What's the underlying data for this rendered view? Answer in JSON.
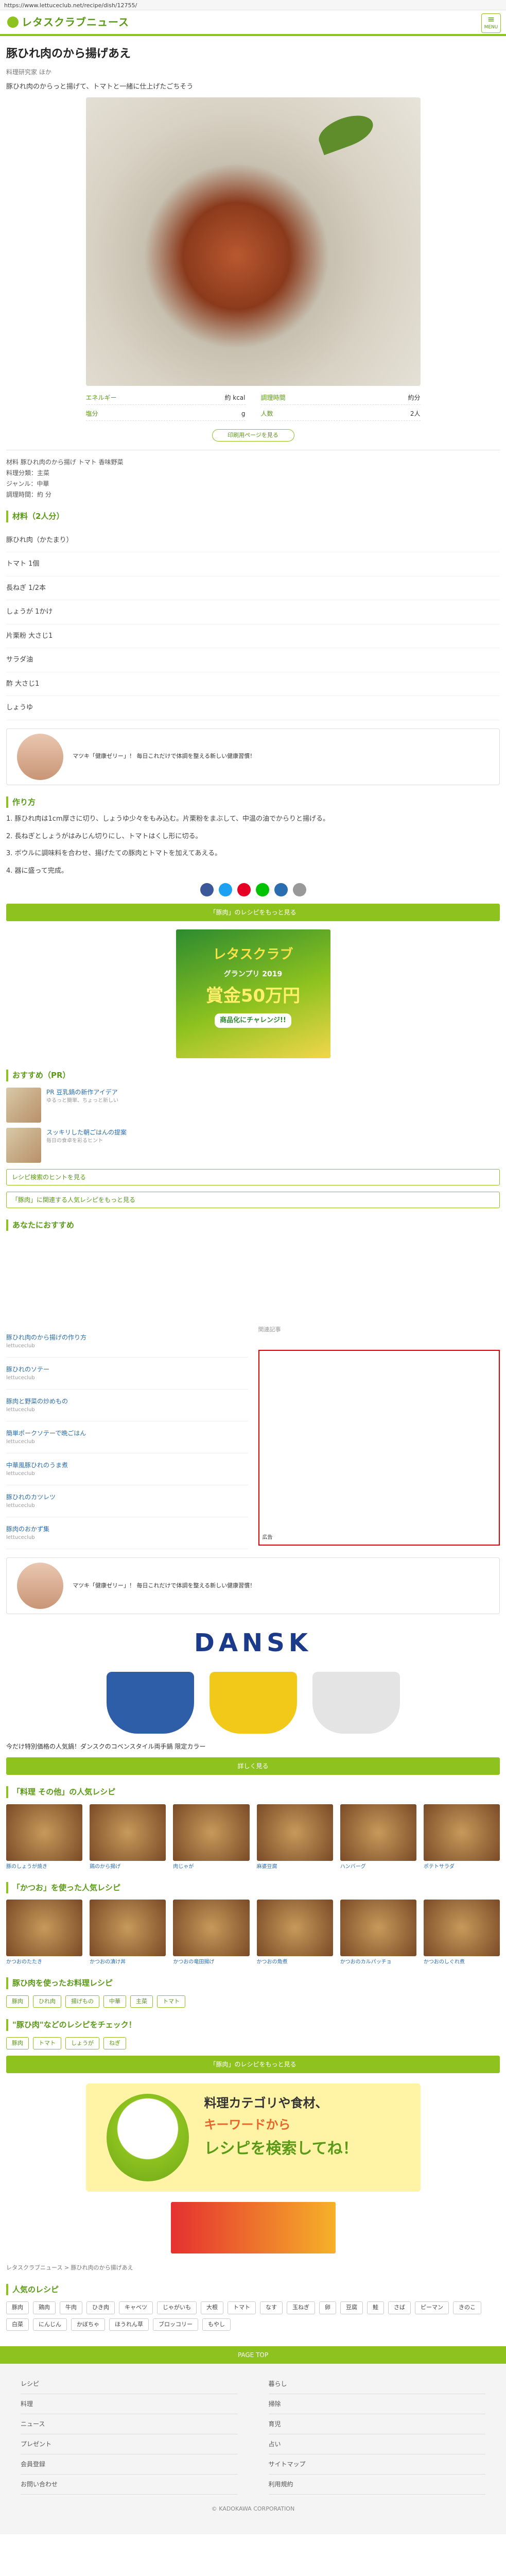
{
  "url": "https://www.lettuceclub.net/recipe/dish/12755/",
  "header": {
    "logo": "レタスクラブニュース",
    "menu_label": "MENU"
  },
  "recipe": {
    "title": "豚ひれ肉のから揚げあえ",
    "author": "料理研究家 ほか",
    "lead": "豚ひれ肉のからっと揚げて、トマトと一緒に仕上げたごちそう",
    "meta": [
      {
        "label": "エネルギー",
        "value": "約 kcal"
      },
      {
        "label": "調理時間",
        "value": "約分"
      },
      {
        "label": "塩分",
        "value": "g"
      },
      {
        "label": "人数",
        "value": "2人"
      }
    ],
    "print_label": "印刷用ページを見る",
    "info_lines": [
      "材料 豚ひれ肉のから揚げ  トマト 香味野菜",
      "料理分類：主菜",
      "ジャンル：中華",
      "調理時間：約 分"
    ]
  },
  "ingredients_heading": "材料（2人分）",
  "ingredients": [
    "豚ひれ肉（かたまり）",
    "トマト 1個",
    "長ねぎ 1/2本",
    "しょうが 1かけ",
    "片栗粉 大さじ1",
    "サラダ油",
    "酢 大さじ1",
    "しょうゆ"
  ],
  "ad_text": "マツキ「健康ゼリー」！ 毎日これだけで体調を整える新しい健康習慣！",
  "steps_heading": "作り方",
  "steps": [
    "1. 豚ひれ肉は1cm厚さに切り、しょうゆ少々をもみ込む。片栗粉をまぶして、中温の油でからりと揚げる。",
    "2. 長ねぎとしょうがはみじん切りにし、トマトはくし形に切る。",
    "3. ボウルに調味料を合わせ、揚げたての豚肉とトマトを加えてあえる。",
    "4. 器に盛って完成。"
  ],
  "more_recipes_bar": "「豚肉」のレシピをもっと見る",
  "banner": {
    "line1": "レタスクラブ",
    "line2": "グランプリ 2019",
    "line3": "賞金50万円",
    "line4": "商品化にチャレンジ!!"
  },
  "pr_heading": "おすすめ（PR）",
  "pr_items": [
    {
      "title": "PR 豆乳鍋の新作アイデア",
      "sub": "ゆるっと簡単、ちょっと新しい"
    },
    {
      "title": "スッキリした朝ごはんの提案",
      "sub": "毎日の食卓を彩るヒント"
    }
  ],
  "pr_bar": "レシピ検索のヒントを見る",
  "pr_bar2": "「豚肉」に関連する人気レシピをもっと見る",
  "rec_heading": "あなたにおすすめ",
  "rec_left": [
    {
      "title": "豚ひれ肉のから揚げの作り方",
      "sub": "lettuceclub"
    },
    {
      "title": "豚ひれのソテー",
      "sub": "lettuceclub"
    },
    {
      "title": "豚肉と野菜の炒めもの",
      "sub": "lettuceclub"
    },
    {
      "title": "簡単ポークソテーで晩ごはん",
      "sub": "lettuceclub"
    },
    {
      "title": "中華風豚ひれのうま煮",
      "sub": "lettuceclub"
    },
    {
      "title": "豚ひれのカツレツ",
      "sub": "lettuceclub"
    },
    {
      "title": "豚肉のおかず集",
      "sub": "lettuceclub"
    }
  ],
  "rec_right_title": "関連記事",
  "red_box_label": "広告",
  "thumbs1_heading": "「料理 その他」の人気レシピ",
  "thumbs1": [
    "豚のしょうが焼き",
    "鶏のから揚げ",
    "肉じゃが",
    "麻婆豆腐",
    "ハンバーグ",
    "ポテトサラダ"
  ],
  "thumbs2_heading": "「かつお」を使った人気レシピ",
  "thumbs2": [
    "かつおのたたき",
    "かつおの漬け丼",
    "かつおの竜田揚げ",
    "かつおの角煮",
    "かつおのカルパッチョ",
    "かつおのしぐれ煮"
  ],
  "dansk": {
    "logo": "DANSK",
    "desc": "今だけ特別価格の人気鍋！ダンスクのコベンスタイル両手鍋 限定カラー",
    "btn": "詳しく見る"
  },
  "tags_heading": "豚ひ肉を使ったお料理レシピ",
  "tags": [
    "豚肉",
    "ひれ肉",
    "揚げもの",
    "中華",
    "主菜",
    "トマト"
  ],
  "tags2_heading": "\"豚ひ肉\"などのレシピをチェック！",
  "tags2": [
    "豚肉",
    "トマト",
    "しょうが",
    "ねぎ"
  ],
  "search_banner": {
    "t1": "料理カテゴリや食材、",
    "t2": "キーワードから",
    "t3": "レシピを検索してね！"
  },
  "breadcrumb": "レタスクラブニュース > 豚ひれ肉のから揚げあえ",
  "popular_heading": "人気のレシピ",
  "popular": [
    "豚肉",
    "鶏肉",
    "牛肉",
    "ひき肉",
    "キャベツ",
    "じゃがいも",
    "大根",
    "トマト",
    "なす",
    "玉ねぎ",
    "卵",
    "豆腐",
    "鮭",
    "さば",
    "ピーマン",
    "きのこ",
    "白菜",
    "にんじん",
    "かぼちゃ",
    "ほうれん草",
    "ブロッコリー",
    "もやし"
  ],
  "pagetop": "PAGE TOP",
  "footer_links": [
    "レシピ",
    "暮らし",
    "料理",
    "掃除",
    "ニュース",
    "育児",
    "プレゼント",
    "占い",
    "会員登録",
    "サイトマップ",
    "お問い合わせ",
    "利用規約"
  ],
  "copyright": "© KADOKAWA CORPORATION"
}
